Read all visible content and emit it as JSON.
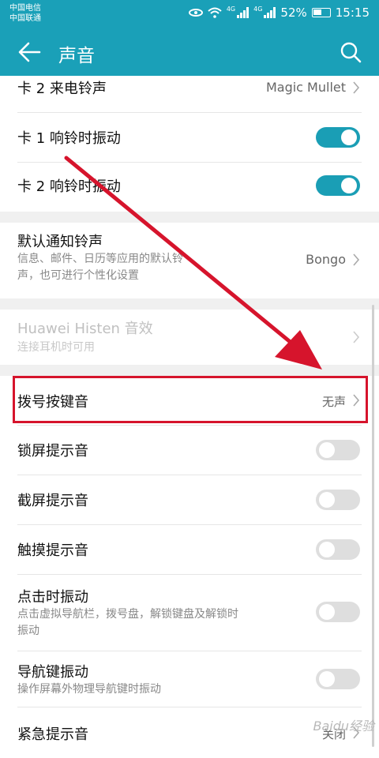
{
  "status": {
    "carrier1": "中国电信",
    "carrier2": "中国联通",
    "net1": "4G",
    "net2": "4G",
    "battery": "52%",
    "time": "15:15"
  },
  "header": {
    "title": "声音"
  },
  "rows": [
    {
      "title": "卡 2 来电铃声",
      "value": "Magic Mullet"
    },
    {
      "title": "卡 1 响铃时振动",
      "toggle": "on"
    },
    {
      "title": "卡 2 响铃时振动",
      "toggle": "on"
    },
    {
      "title": "默认通知铃声",
      "sub": "信息、邮件、日历等应用的默认铃\n声，也可进行个性化设置",
      "value": "Bongo"
    },
    {
      "title": "Huawei Histen 音效",
      "sub": "连接耳机时可用",
      "disabled": true
    },
    {
      "title": "拨号按键音",
      "value": "无声"
    },
    {
      "title": "锁屏提示音",
      "toggle": "off"
    },
    {
      "title": "截屏提示音",
      "toggle": "off"
    },
    {
      "title": "触摸提示音",
      "toggle": "off"
    },
    {
      "title": "点击时振动",
      "sub": "点击虚拟导航栏，拨号盘，解锁键盘及解锁时\n振动",
      "toggle": "off"
    },
    {
      "title": "导航键振动",
      "sub": "操作屏幕外物理导航键时振动",
      "toggle": "off"
    },
    {
      "title": "紧急提示音",
      "value": "关闭"
    }
  ],
  "watermark": "Baidu经验",
  "colors": {
    "accent": "#1aa0b8",
    "annotation": "#d6142c"
  }
}
